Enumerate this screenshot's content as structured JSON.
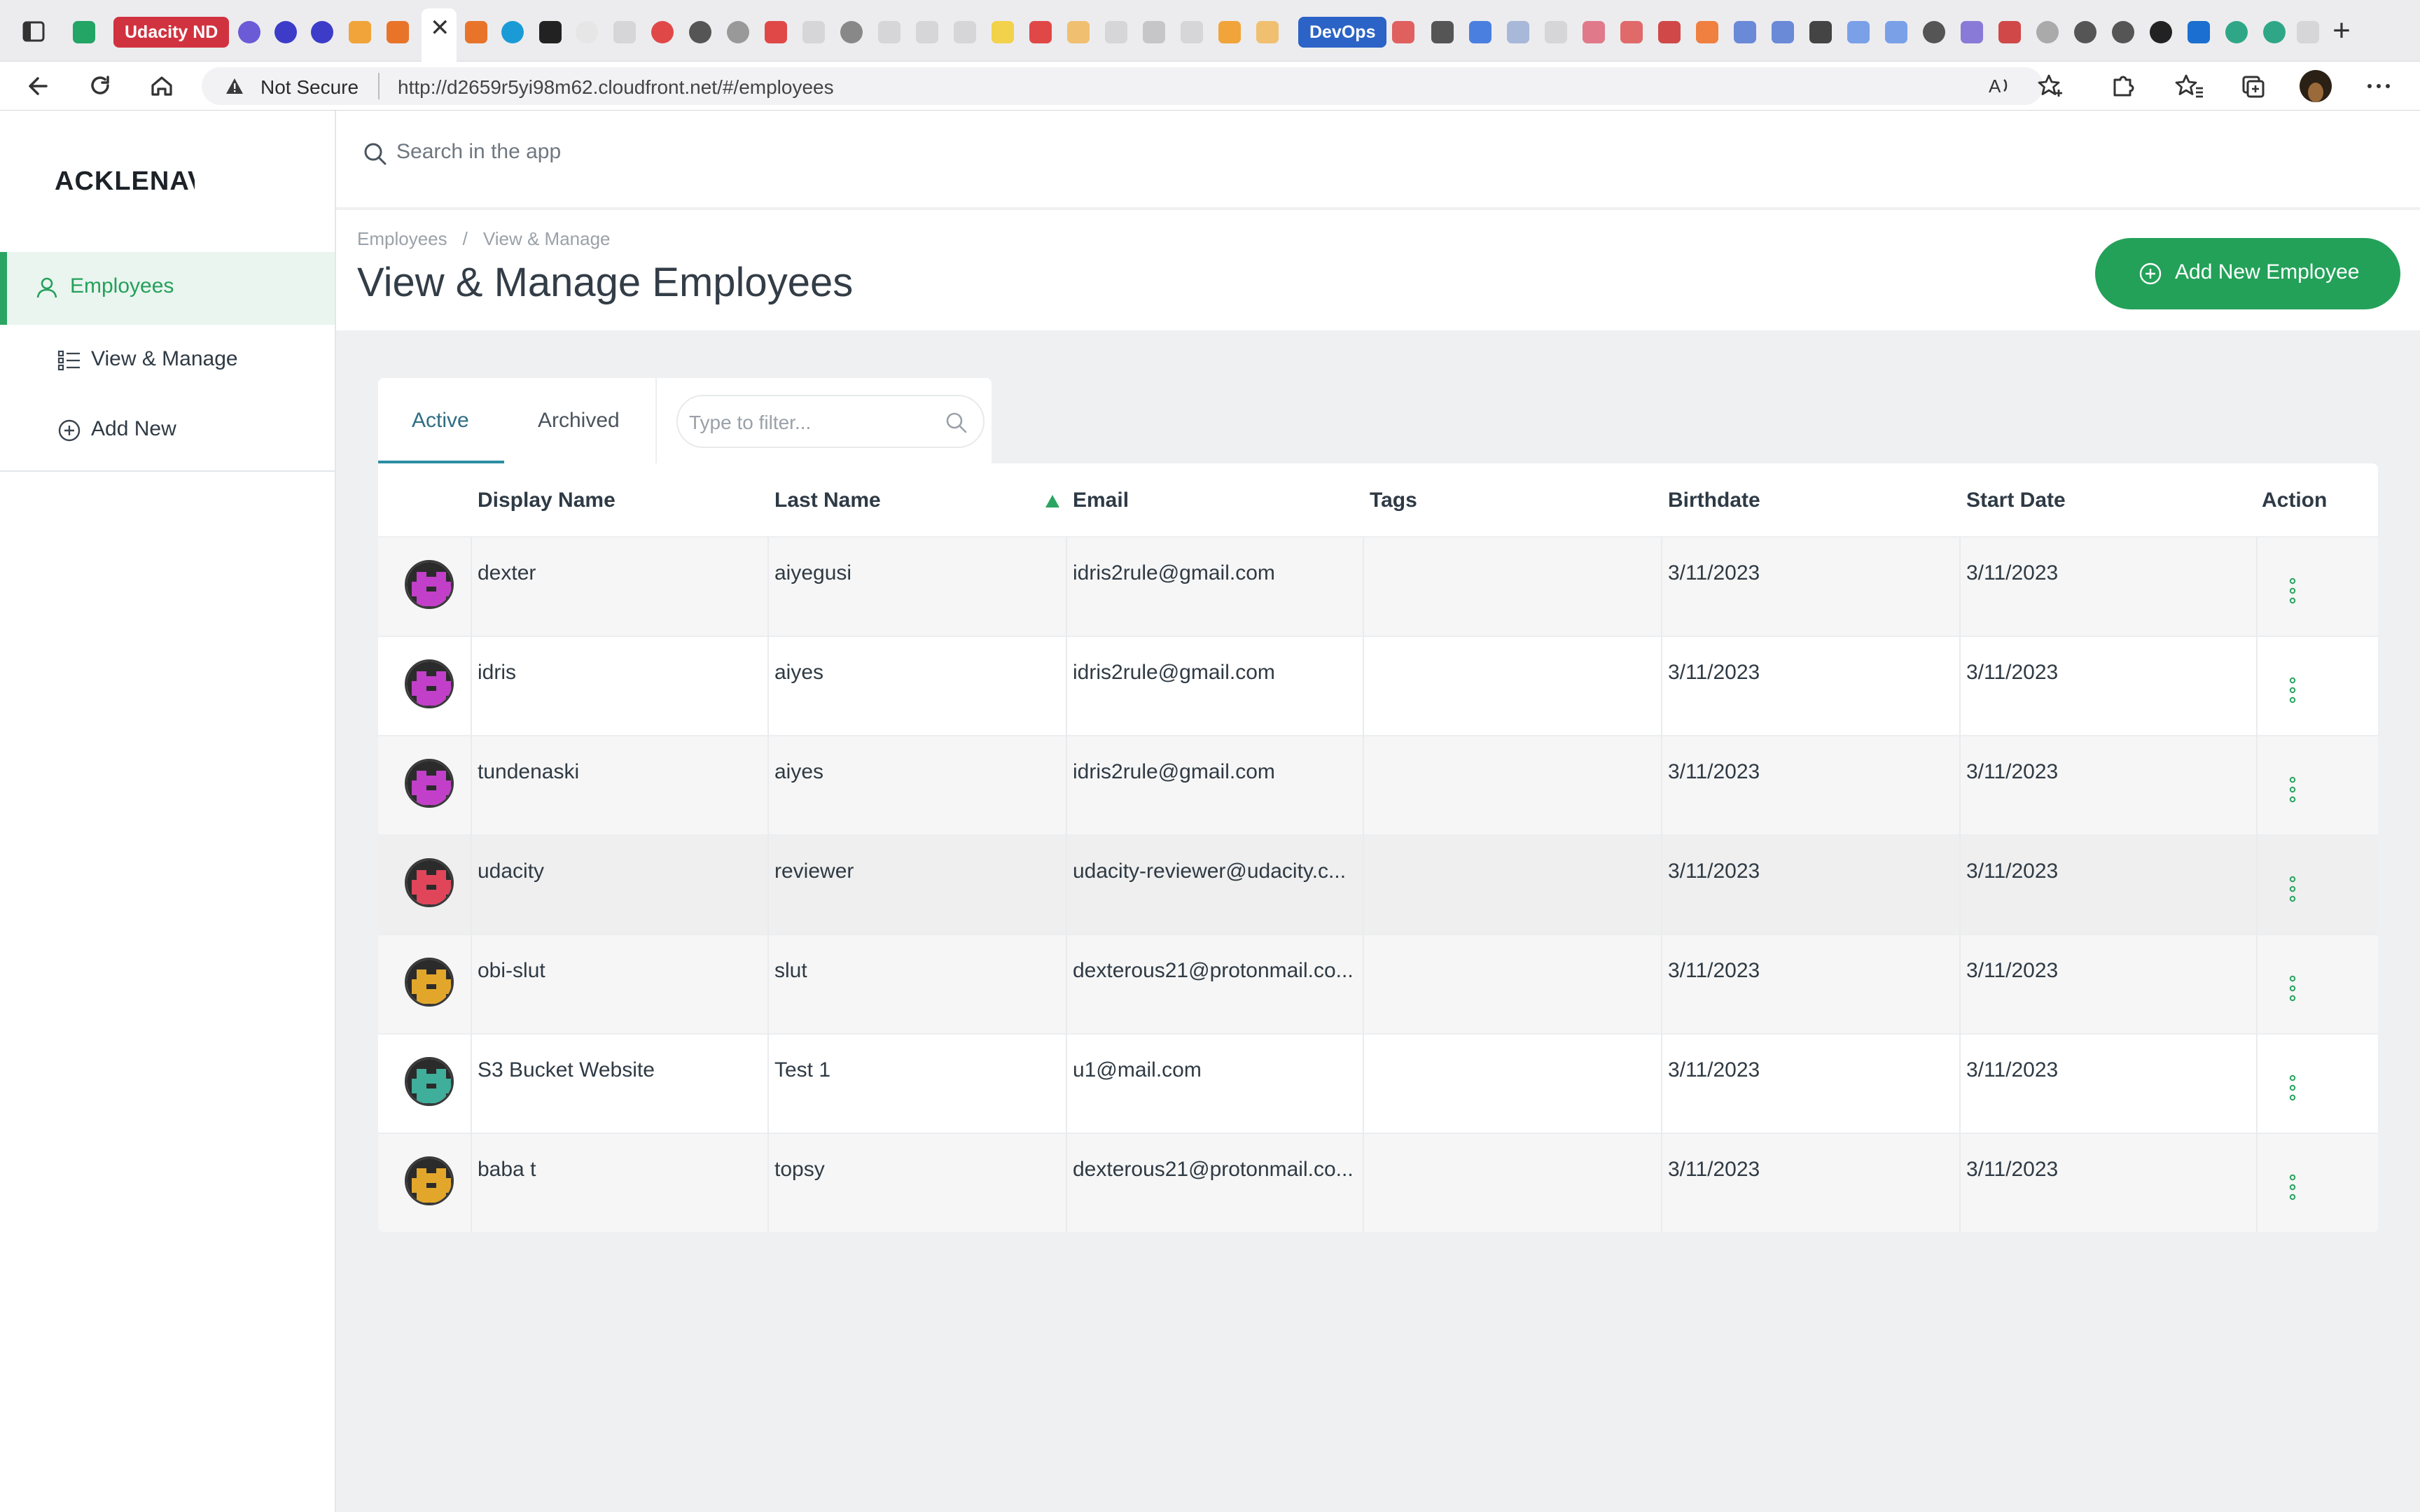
{
  "browser": {
    "udacity_tab_label": "Udacity ND",
    "devops_tab_label": "DevOps",
    "active_tab_close": "✕",
    "new_tab": "+",
    "security_label": "Not Secure",
    "url": "http://d2659r5yi98m62.cloudfront.net/#/employees"
  },
  "sidebar": {
    "logo": "ACKLENAVENUE",
    "items": [
      {
        "label": "Employees",
        "icon": "user-icon",
        "active": true
      },
      {
        "label": "View & Manage",
        "icon": "list-icon",
        "active": false
      },
      {
        "label": "Add New",
        "icon": "plus-circle-icon",
        "active": false
      }
    ]
  },
  "search": {
    "placeholder": "Search in the app"
  },
  "header": {
    "breadcrumb": [
      "Employees",
      "/",
      "View & Manage"
    ],
    "title": "View & Manage Employees",
    "add_button": "Add New Employee"
  },
  "tabs": [
    {
      "label": "Active",
      "active": true
    },
    {
      "label": "Archived",
      "active": false
    }
  ],
  "filter": {
    "placeholder": "Type to filter..."
  },
  "table": {
    "columns": [
      "Display Name",
      "Last Name",
      "Email",
      "Tags",
      "Birthdate",
      "Start Date",
      "Action"
    ],
    "sorted_column": "Email",
    "rows": [
      {
        "display_name": "dexter",
        "last_name": "aiyegusi",
        "email": "idris2rule@gmail.com",
        "tags": "",
        "birthdate": "3/11/2023",
        "start_date": "3/11/2023",
        "avatar_color": "#c23fc9"
      },
      {
        "display_name": "idris",
        "last_name": "aiyes",
        "email": "idris2rule@gmail.com",
        "tags": "",
        "birthdate": "3/11/2023",
        "start_date": "3/11/2023",
        "avatar_color": "#c23fc9"
      },
      {
        "display_name": "tundenaski",
        "last_name": "aiyes",
        "email": "idris2rule@gmail.com",
        "tags": "",
        "birthdate": "3/11/2023",
        "start_date": "3/11/2023",
        "avatar_color": "#c23fc9"
      },
      {
        "display_name": "udacity",
        "last_name": "reviewer",
        "email": "udacity-reviewer@udacity.c...",
        "tags": "",
        "birthdate": "3/11/2023",
        "start_date": "3/11/2023",
        "avatar_color": "#e0455a"
      },
      {
        "display_name": "obi-slut",
        "last_name": "slut",
        "email": "dexterous21@protonmail.co...",
        "tags": "",
        "birthdate": "3/11/2023",
        "start_date": "3/11/2023",
        "avatar_color": "#e2a72a"
      },
      {
        "display_name": "S3 Bucket Website",
        "last_name": "Test 1",
        "email": "u1@mail.com",
        "tags": "",
        "birthdate": "3/11/2023",
        "start_date": "3/11/2023",
        "avatar_color": "#3fae9a"
      },
      {
        "display_name": "baba t",
        "last_name": "topsy",
        "email": "dexterous21@protonmail.co...",
        "tags": "",
        "birthdate": "3/11/2023",
        "start_date": "3/11/2023",
        "avatar_color": "#e2a72a"
      }
    ]
  },
  "colors": {
    "accent": "#23a159",
    "sidebar_active_bg": "#eaf5ef",
    "tab_underline": "#2d8da3"
  }
}
